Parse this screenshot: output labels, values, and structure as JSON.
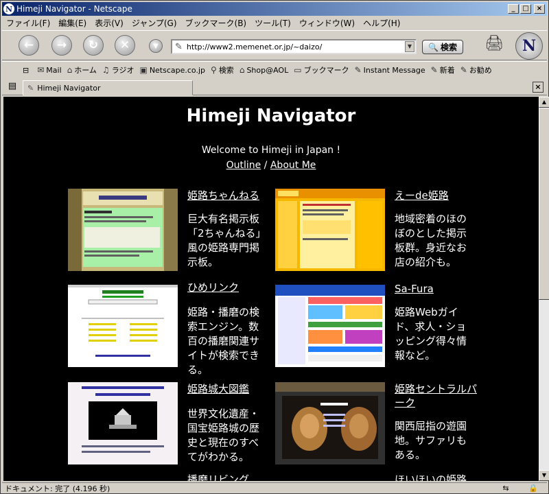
{
  "window": {
    "title": "Himeji Navigator - Netscape"
  },
  "menu": [
    "ファイル(F)",
    "編集(E)",
    "表示(V)",
    "ジャンプ(G)",
    "ブックマーク(B)",
    "ツール(T)",
    "ウィンドウ(W)",
    "ヘルプ(H)"
  ],
  "navbar": {
    "url": "http://www2.memenet.or.jp/~daizo/",
    "search_label": "検索"
  },
  "personal_toolbar": [
    "Mail",
    "ホーム",
    "ラジオ",
    "Netscape.co.jp",
    "検索",
    "Shop@AOL",
    "ブックマーク",
    "Instant Message",
    "新着",
    "お勧め"
  ],
  "tab": {
    "label": "Himeji Navigator"
  },
  "page": {
    "title": "Himeji Navigator",
    "welcome": "Welcome to Himeji in Japan !",
    "link_outline": "Outline",
    "separator": " / ",
    "link_about": "About Me",
    "sites": [
      {
        "name": "姫路ちゃんねる",
        "desc": "巨大有名掲示板「2ちゃんねる」風の姫路専門掲示板。"
      },
      {
        "name": "えーde姫路",
        "desc": "地域密着のほのぼのとした掲示板群。身近なお店の紹介も。"
      },
      {
        "name": "ひめリンク",
        "desc": "姫路・播磨の検索エンジン。数百の播磨関連サイトが検索できる。"
      },
      {
        "name": "Sa-Fura",
        "desc": "姫路Webガイド、求人・ショッピング得々情報など。"
      },
      {
        "name": "姫路城大図鑑",
        "desc": "世界文化遺産・国宝姫路城の歴史と現在のすべてがわかる。"
      },
      {
        "name": "姫路セントラルパーク",
        "desc": "関西屈指の遊園地。サファリもある。"
      },
      {
        "name": "播磨リビング",
        "desc": ""
      },
      {
        "name": "ほいほいの姫路",
        "desc": ""
      }
    ]
  },
  "status": {
    "text": "ドキュメント: 完了 (4.196 秒)"
  }
}
